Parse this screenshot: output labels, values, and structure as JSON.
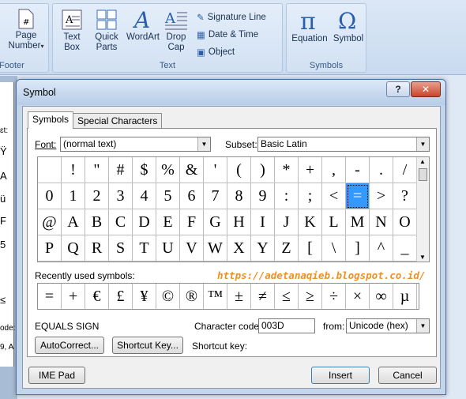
{
  "ribbon": {
    "page_number": "Page\nNumber",
    "footer_group": "Footer",
    "text_box": "Text\nBox",
    "quick_parts": "Quick\nParts",
    "wordart": "WordArt",
    "drop_cap": "Drop\nCap",
    "signature_line": "Signature Line",
    "date_time": "Date & Time",
    "object": "Object",
    "text_group": "Text",
    "equation": "Equation",
    "symbol": "Symbol",
    "symbols_group": "Symbols",
    "page_icon_glyph": "#",
    "textbox_icon_glyph": "A",
    "wordart_icon_glyph": "A",
    "dropcap_icon_glyph": "A",
    "equation_icon_glyph": "π",
    "symbol_icon_glyph": "Ω",
    "caret": "▾"
  },
  "document_left": [
    "ɛt:",
    "Ÿ",
    "A",
    "ü",
    "F",
    "5",
    "≤",
    "ode:",
    "9, A"
  ],
  "dialog": {
    "title": "Symbol",
    "help": "?",
    "close": "✕",
    "tabs": [
      "Symbols",
      "Special Characters"
    ],
    "font_label": "Font:",
    "font_value": "(normal text)",
    "subset_label": "Subset:",
    "subset_value": "Basic Latin",
    "grid_rows": [
      [
        "",
        "!",
        "\"",
        "#",
        "$",
        "%",
        "&",
        "'",
        "(",
        ")",
        "*",
        "+",
        ",",
        "-",
        ".",
        "/"
      ],
      [
        "0",
        "1",
        "2",
        "3",
        "4",
        "5",
        "6",
        "7",
        "8",
        "9",
        ":",
        ";",
        "<",
        "=",
        ">",
        "?"
      ],
      [
        "@",
        "A",
        "B",
        "C",
        "D",
        "E",
        "F",
        "G",
        "H",
        "I",
        "J",
        "K",
        "L",
        "M",
        "N",
        "O"
      ],
      [
        "P",
        "Q",
        "R",
        "S",
        "T",
        "U",
        "V",
        "W",
        "X",
        "Y",
        "Z",
        "[",
        "\\",
        "]",
        "^",
        "_"
      ]
    ],
    "selected": "=",
    "recent_label": "Recently used symbols:",
    "watermark_url": "https://adetanaqieb.blogspot.co.id/",
    "recent": [
      "=",
      "+",
      "€",
      "£",
      "¥",
      "©",
      "®",
      "™",
      "±",
      "≠",
      "≤",
      "≥",
      "÷",
      "×",
      "∞",
      "µ"
    ],
    "symbol_name": "EQUALS SIGN",
    "char_code_label": "Character code:",
    "char_code_value": "003D",
    "from_label": "from:",
    "from_value": "Unicode (hex)",
    "autocorrect": "AutoCorrect...",
    "shortcut_key_button": "Shortcut Key...",
    "shortcut_key_label": "Shortcut key:",
    "ime_pad": "IME Pad",
    "insert": "Insert",
    "cancel": "Cancel",
    "dropdown_arrow": "▼"
  },
  "colors": {
    "selection": "#3399ff",
    "watermark": "#f09020",
    "ribbon_bg": "#d2e1f3"
  }
}
